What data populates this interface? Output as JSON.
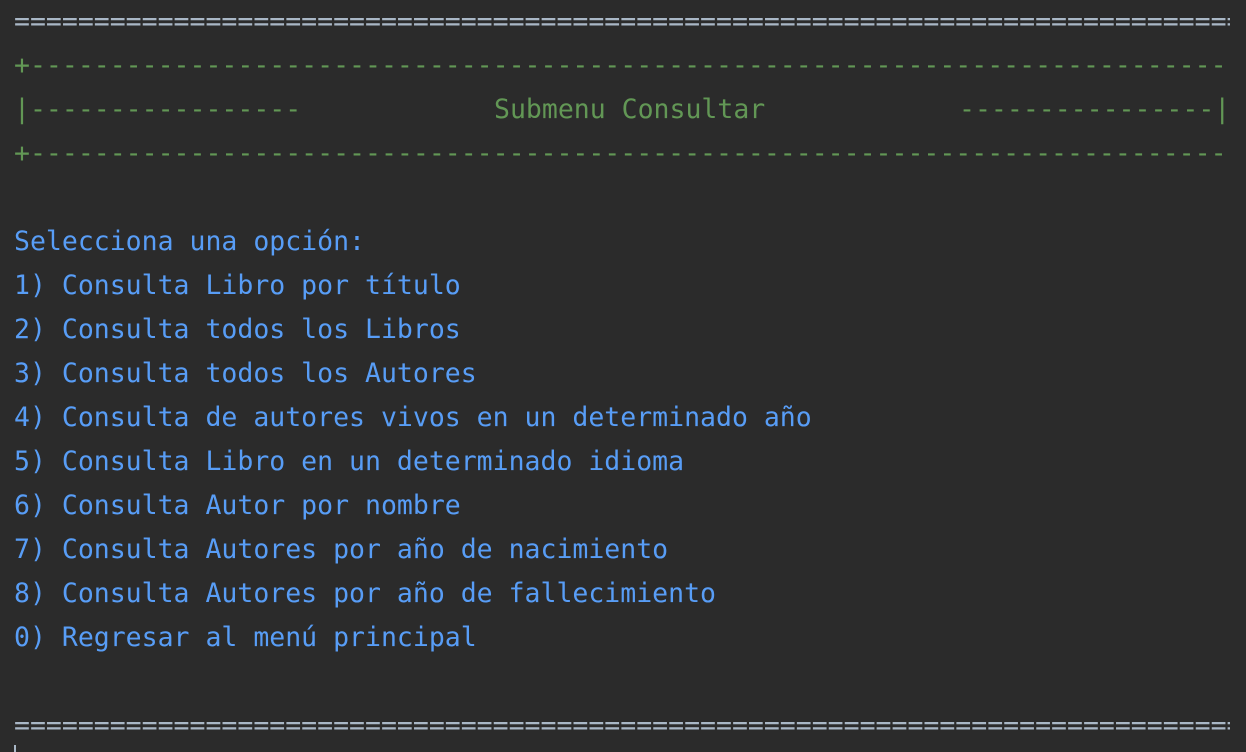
{
  "rules": {
    "top_equals": "==============================================================================",
    "bottom_equals": "==============================================================================",
    "plus_dash": "+----------------------------------------------------------------------------+"
  },
  "banner": {
    "left": "|-----------------",
    "title": "Submenu Consultar",
    "right": "----------------|"
  },
  "menu": {
    "prompt": "Selecciona una opción:",
    "options": [
      "1) Consulta Libro por título",
      "2) Consulta todos los Libros",
      "3) Consulta todos los Autores",
      "4) Consulta de autores vivos en un determinado año",
      "5) Consulta Libro en un determinado idioma",
      "6) Consulta Autor por nombre",
      "7) Consulta Autores por año de nacimiento",
      "8) Consulta Autores por año de fallecimiento",
      "0) Regresar al menú principal"
    ]
  },
  "colors": {
    "background": "#2b2b2b",
    "rule_gray": "#a9b7c6",
    "banner_green": "#629755",
    "menu_blue": "#589df6"
  }
}
